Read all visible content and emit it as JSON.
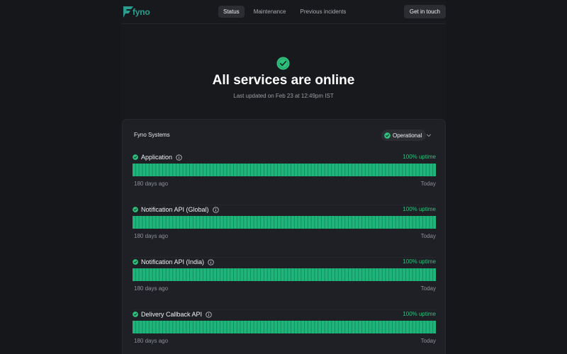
{
  "header": {
    "brand": "fyno",
    "nav": [
      {
        "label": "Status",
        "active": true
      },
      {
        "label": "Maintenance",
        "active": false
      },
      {
        "label": "Previous incidents",
        "active": false
      }
    ],
    "cta_label": "Get in touch"
  },
  "hero": {
    "title": "All services are online",
    "subtitle": "Last updated on Feb 23 at 12:49pm IST"
  },
  "card": {
    "title": "Fyno Systems",
    "status": "Operational",
    "services": [
      {
        "name": "Application",
        "uptime": "100% uptime",
        "start_label": "180 days ago",
        "end_label": "Today"
      },
      {
        "name": "Notification API (Global)",
        "uptime": "100% uptime",
        "start_label": "180 days ago",
        "end_label": "Today"
      },
      {
        "name": "Notification API (India)",
        "uptime": "100% uptime",
        "start_label": "180 days ago",
        "end_label": "Today"
      },
      {
        "name": "Delivery Callback API",
        "uptime": "100% uptime",
        "start_label": "180 days ago",
        "end_label": "Today"
      }
    ]
  },
  "colors": {
    "accent_green": "#2ec27e",
    "bar_green": "#1fb57a",
    "brand_teal": "#2a9d8f",
    "background": "#16171b"
  },
  "icons": {
    "status_ok": "check-circle-icon",
    "info": "info-icon",
    "expand": "chevron-down-icon",
    "brand": "fyno-logo-icon"
  }
}
